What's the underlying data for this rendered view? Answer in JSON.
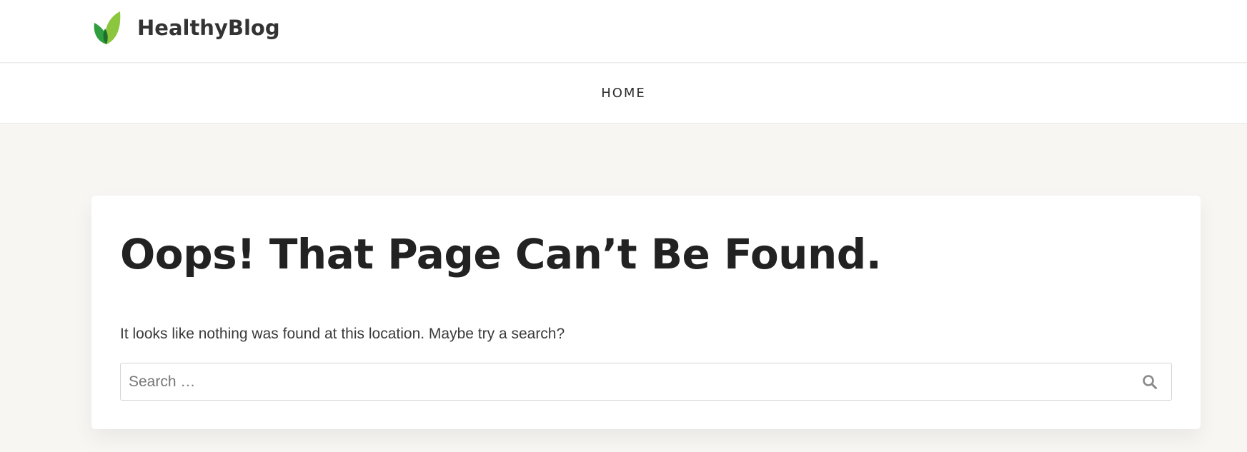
{
  "header": {
    "site_title": "HealthyBlog",
    "logo_icon": "leaf-logo-icon",
    "colors": {
      "leaf_dark": "#2e9e3f",
      "leaf_light": "#8cc63f",
      "leaf_shadow": "#1f6f2c"
    }
  },
  "nav": {
    "items": [
      {
        "label": "HOME"
      }
    ]
  },
  "main": {
    "title": "Oops! That Page Can’t Be Found.",
    "message": "It looks like nothing was found at this location. Maybe try a search?",
    "search": {
      "placeholder": "Search …",
      "value": "",
      "submit_icon": "search-icon"
    }
  },
  "colors": {
    "page_background": "#f7f6f3",
    "card_background": "#ffffff",
    "heading": "#222222",
    "body_text": "#3a3a3a"
  }
}
